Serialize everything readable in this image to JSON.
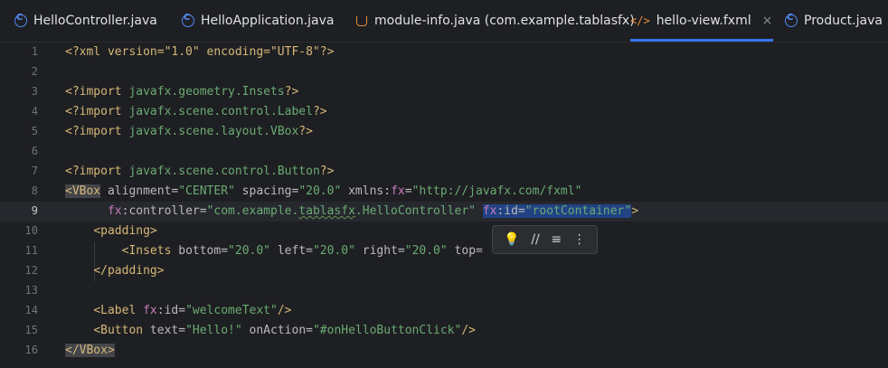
{
  "tabs": [
    {
      "label": "HelloController.java",
      "icon": "java-class-icon"
    },
    {
      "label": "HelloApplication.java",
      "icon": "java-class-icon"
    },
    {
      "label": "module-info.java (com.example.tablasfx)",
      "icon": "module-icon"
    },
    {
      "label": "hello-view.fxml",
      "icon": "xml-file-icon",
      "active": true
    },
    {
      "label": "Product.java",
      "icon": "java-class-icon"
    }
  ],
  "close_glyph": "×",
  "line_numbers": [
    "1",
    "2",
    "3",
    "4",
    "5",
    "6",
    "7",
    "8",
    "9",
    "10",
    "11",
    "12",
    "13",
    "14",
    "15",
    "16"
  ],
  "current_line": 9,
  "code": {
    "l1": "<?xml version=\"1.0\" encoding=\"UTF-8\"?>",
    "l3a": "<?import ",
    "l3b": "javafx.geometry.Insets",
    "l3c": "?>",
    "l4a": "<?import ",
    "l4b": "javafx.scene.control.Label",
    "l4c": "?>",
    "l5a": "<?import ",
    "l5b": "javafx.scene.layout.VBox",
    "l5c": "?>",
    "l7a": "<?import ",
    "l7b": "javafx.scene.control.Button",
    "l7c": "?>",
    "l8_tag": "<VBox",
    "l8_attr1": " alignment=",
    "l8_val1": "\"CENTER\"",
    "l8_attr2": " spacing=",
    "l8_val2": "\"20.0\"",
    "l8_attr3": " xmlns:",
    "l8_ns": "fx",
    "l8_eq": "=",
    "l8_val3": "\"http://javafx.com/fxml\"",
    "l9_ns": "fx",
    "l9_attr": ":controller=",
    "l9_val_a": "\"com.example.",
    "l9_val_typo": "tablasfx",
    "l9_val_b": ".HelloController\"",
    "l9_sel_ns": "fx",
    "l9_sel_attr": ":id=",
    "l9_sel_val": "\"rootContainer\"",
    "l9_close": ">",
    "l10": "<padding>",
    "l11_tag": "<Insets",
    "l11_attr1": " bottom=",
    "l11_val1": "\"20.0\"",
    "l11_attr2": " left=",
    "l11_val2": "\"20.0\"",
    "l11_attr3": " right=",
    "l11_val3": "\"20.0\"",
    "l11_attr4": " top=",
    "l12": "</padding>",
    "l14_tag": "<Label ",
    "l14_ns": "fx",
    "l14_attr": ":id=",
    "l14_val": "\"welcomeText\"",
    "l14_end": "/>",
    "l15_tag": "<Button",
    "l15_attr1": " text=",
    "l15_val1": "\"Hello!\"",
    "l15_attr2": " onAction=",
    "l15_val2": "\"#onHelloButtonClick\"",
    "l15_end": "/>",
    "l16": "</VBox>"
  },
  "popup": {
    "actions": [
      "lightbulb-icon",
      "comment-icon",
      "reformat-icon",
      "more-icon"
    ],
    "glyphs": [
      "💡",
      "//",
      "≡",
      "⋮"
    ]
  }
}
